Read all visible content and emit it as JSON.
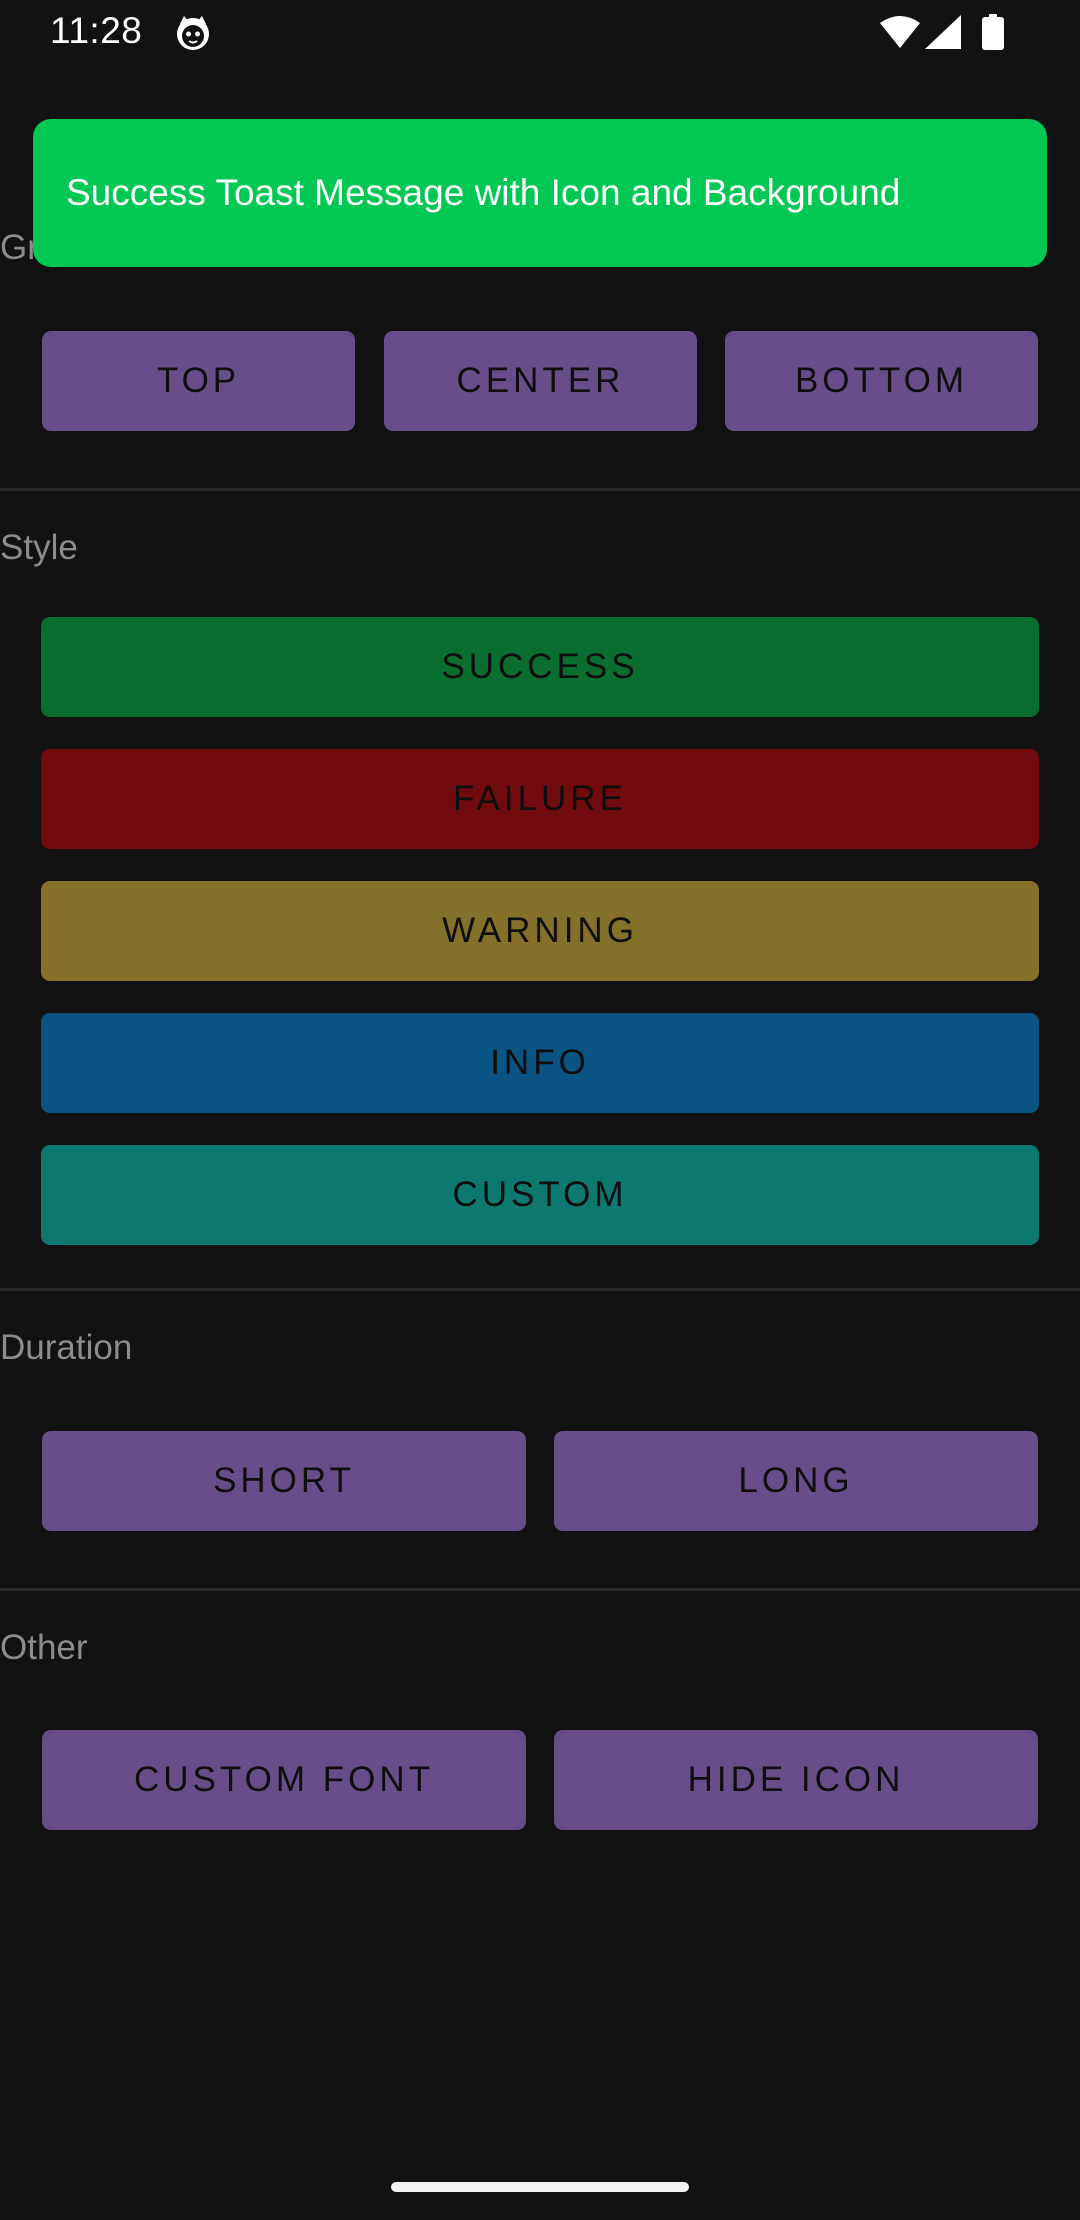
{
  "status_bar": {
    "time": "11:28",
    "notification_icon": "cat-face-icon",
    "wifi_icon": "wifi-icon",
    "signal_icon": "cell-signal-icon",
    "battery_icon": "battery-icon"
  },
  "toast": {
    "message": "Success Toast Message with Icon and Background",
    "background_color": "#00c853"
  },
  "sections": {
    "gravity": {
      "label_visible_fragment": "Gr",
      "buttons": [
        "TOP",
        "CENTER",
        "BOTTOM"
      ]
    },
    "style": {
      "label": "Style",
      "buttons": [
        {
          "label": "SUCCESS",
          "color": "#0a6e31"
        },
        {
          "label": "FAILURE",
          "color": "#720b0e"
        },
        {
          "label": "WARNING",
          "color": "#85702a"
        },
        {
          "label": "INFO",
          "color": "#0a5483"
        },
        {
          "label": "CUSTOM",
          "color": "#0d7870"
        }
      ]
    },
    "duration": {
      "label": "Duration",
      "buttons": [
        "SHORT",
        "LONG"
      ]
    },
    "other": {
      "label": "Other",
      "buttons": [
        "CUSTOM FONT",
        "HIDE ICON"
      ]
    }
  },
  "colors": {
    "background": "#121212",
    "button_purple": "#674e8b",
    "section_label": "#8c8c8c",
    "divider": "#2a2a2a"
  }
}
